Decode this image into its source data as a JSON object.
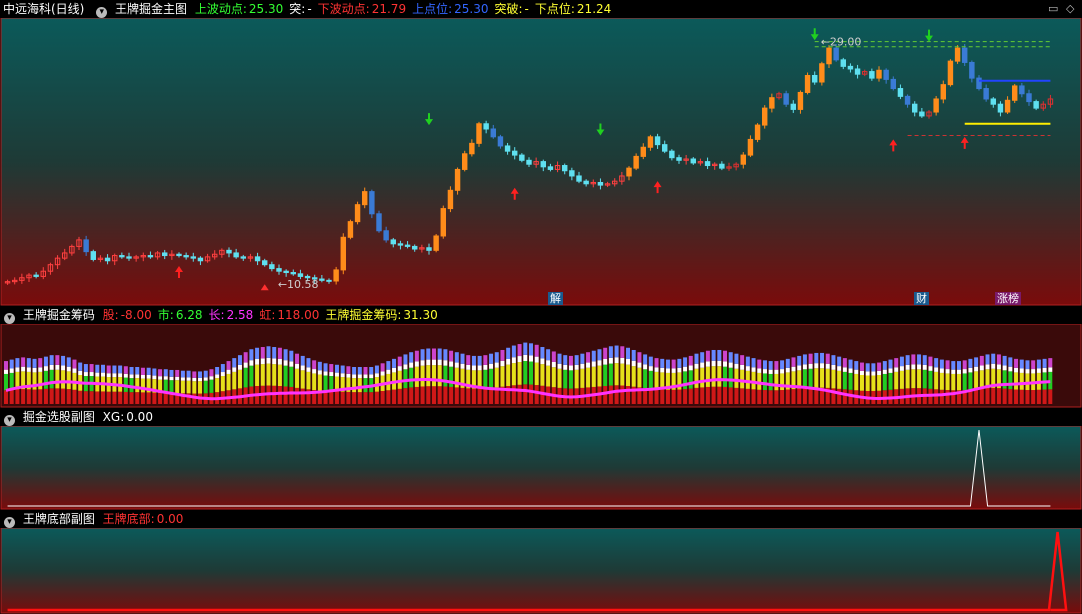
{
  "main": {
    "stock": "中远海科(日线)",
    "indicator": "王牌掘金主图",
    "fields": [
      {
        "label": "上波动点:",
        "value": "25.30",
        "color": "#33ff33"
      },
      {
        "label": "突:",
        "value": "-",
        "color": "#ffffff"
      },
      {
        "label": "下波动点:",
        "value": "21.79",
        "color": "#ff3333"
      },
      {
        "label": "上点位:",
        "value": "25.30",
        "color": "#3366ff"
      },
      {
        "label": "突破:",
        "value": "-",
        "color": "#ffff33"
      },
      {
        "label": "下点位:",
        "value": "21.24",
        "color": "#ffff33"
      }
    ],
    "tags": [
      "解",
      "财",
      "涨榜"
    ]
  },
  "sub1": {
    "title": "王牌掘金筹码",
    "fields": [
      {
        "label": "股:",
        "value": "-8.00",
        "color": "#ff3333"
      },
      {
        "label": "市:",
        "value": "6.28",
        "color": "#33ff33"
      },
      {
        "label": "长:",
        "value": "2.58",
        "color": "#ff33ff"
      },
      {
        "label": "虹:",
        "value": "118.00",
        "color": "#ff3333"
      },
      {
        "label": "王牌掘金筹码:",
        "value": "31.30",
        "color": "#ffff33"
      }
    ]
  },
  "sub2": {
    "title": "掘金选股副图",
    "fields": [
      {
        "label": "XG:",
        "value": "0.00",
        "color": "#ffffff"
      }
    ]
  },
  "sub3": {
    "title": "王牌底部副图",
    "fields": [
      {
        "label": "王牌底部:",
        "value": "0.00",
        "color": "#ff3333"
      }
    ]
  },
  "chart_data": [
    {
      "type": "candlestick",
      "title": "王牌掘金主图",
      "ylim": [
        9.5,
        30.5
      ],
      "annotations": [
        {
          "text": "29.00",
          "value": 29.0
        },
        {
          "text": "10.58",
          "value": 10.58
        }
      ],
      "close": [
        10.6,
        10.7,
        10.9,
        11.1,
        11.0,
        11.4,
        11.9,
        12.4,
        12.8,
        13.3,
        13.8,
        12.9,
        12.3,
        12.4,
        12.2,
        12.6,
        12.5,
        12.4,
        12.5,
        12.6,
        12.5,
        12.8,
        12.6,
        12.7,
        12.6,
        12.5,
        12.4,
        12.2,
        12.5,
        12.7,
        13.0,
        12.8,
        12.5,
        12.4,
        12.5,
        12.2,
        11.9,
        11.6,
        11.4,
        11.3,
        11.2,
        11.0,
        10.9,
        10.8,
        10.7,
        10.65,
        11.5,
        14.0,
        15.2,
        16.5,
        17.5,
        15.8,
        14.5,
        13.8,
        13.5,
        13.4,
        13.3,
        13.1,
        13.2,
        13.0,
        14.1,
        16.2,
        17.6,
        19.2,
        20.4,
        21.2,
        22.7,
        22.3,
        21.7,
        21.0,
        20.6,
        20.3,
        19.9,
        19.6,
        19.8,
        19.4,
        19.2,
        19.5,
        19.1,
        18.7,
        18.3,
        18.1,
        18.2,
        18.0,
        18.1,
        18.3,
        18.7,
        19.3,
        20.2,
        20.9,
        21.7,
        21.1,
        20.6,
        20.1,
        19.9,
        20.0,
        19.7,
        19.8,
        19.5,
        19.6,
        19.3,
        19.4,
        19.6,
        20.3,
        21.5,
        22.6,
        23.9,
        24.7,
        25.0,
        24.2,
        23.8,
        25.1,
        26.4,
        25.9,
        27.3,
        28.5,
        27.6,
        27.1,
        26.9,
        26.5,
        26.7,
        26.2,
        26.8,
        26.1,
        25.4,
        24.8,
        24.2,
        23.6,
        23.3,
        23.6,
        24.6,
        25.7,
        27.5,
        28.5,
        27.4,
        26.2,
        25.4,
        24.6,
        24.2,
        23.6,
        24.5,
        25.6,
        25.0,
        24.4,
        23.9,
        24.2,
        24.6
      ]
    },
    {
      "type": "bar",
      "title": "王牌掘金筹码",
      "values": [
        0.58,
        0.6,
        0.62,
        0.63,
        0.62,
        0.61,
        0.62,
        0.64,
        0.66,
        0.66,
        0.65,
        0.63,
        0.6,
        0.56,
        0.54,
        0.54,
        0.53,
        0.53,
        0.52,
        0.52,
        0.52,
        0.51,
        0.5,
        0.5,
        0.49,
        0.49,
        0.48,
        0.47,
        0.47,
        0.46,
        0.46,
        0.45,
        0.45,
        0.44,
        0.44,
        0.45,
        0.47,
        0.5,
        0.54,
        0.58,
        0.62,
        0.66,
        0.7,
        0.74,
        0.76,
        0.77,
        0.78,
        0.77,
        0.76,
        0.74,
        0.72,
        0.68,
        0.65,
        0.62,
        0.59,
        0.57,
        0.55,
        0.54,
        0.53,
        0.52,
        0.51,
        0.5,
        0.5,
        0.5,
        0.5,
        0.52,
        0.55,
        0.58,
        0.61,
        0.64,
        0.67,
        0.7,
        0.72,
        0.74,
        0.75,
        0.75,
        0.75,
        0.74,
        0.72,
        0.7,
        0.68,
        0.66,
        0.65,
        0.65,
        0.66,
        0.68,
        0.7,
        0.73,
        0.76,
        0.79,
        0.81,
        0.83,
        0.82,
        0.8,
        0.77,
        0.74,
        0.71,
        0.68,
        0.66,
        0.65,
        0.66,
        0.68,
        0.7,
        0.72,
        0.74,
        0.76,
        0.78,
        0.79,
        0.78,
        0.76,
        0.73,
        0.7,
        0.67,
        0.64,
        0.62,
        0.61,
        0.6,
        0.6,
        0.61,
        0.63,
        0.65,
        0.68,
        0.7,
        0.72,
        0.73,
        0.73,
        0.72,
        0.7,
        0.68,
        0.66,
        0.64,
        0.62,
        0.6,
        0.59,
        0.58,
        0.58,
        0.59,
        0.61,
        0.63,
        0.65,
        0.67,
        0.68,
        0.69,
        0.69,
        0.68,
        0.66,
        0.64,
        0.62,
        0.6,
        0.58,
        0.56,
        0.55,
        0.55,
        0.56,
        0.58,
        0.6,
        0.62,
        0.64,
        0.66,
        0.67,
        0.67,
        0.66,
        0.64,
        0.62,
        0.6,
        0.59,
        0.58,
        0.58,
        0.59,
        0.61,
        0.63,
        0.65,
        0.67,
        0.68,
        0.67,
        0.65,
        0.63,
        0.61,
        0.6,
        0.59,
        0.59,
        0.6,
        0.61,
        0.62
      ]
    },
    {
      "type": "line",
      "title": "掘金选股副图",
      "series": [
        {
          "name": "XG",
          "peak_index": 136,
          "peak_value": 1,
          "base_value": 0
        }
      ]
    },
    {
      "type": "line",
      "title": "王牌底部副图",
      "series": [
        {
          "name": "王牌底部",
          "peak_index": 147,
          "peak_value": 1,
          "base_value": 0
        }
      ]
    }
  ]
}
